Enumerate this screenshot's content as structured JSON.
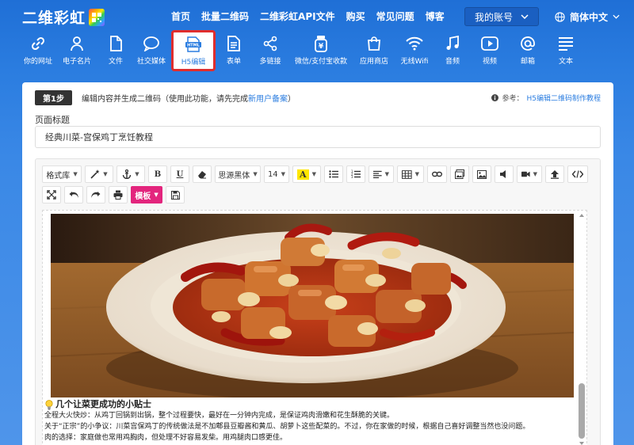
{
  "brand": {
    "name": "二维彩虹"
  },
  "nav": {
    "links": [
      "首页",
      "批量二维码",
      "二维彩虹API文件",
      "购买",
      "常见问题",
      "博客"
    ],
    "account": "我的账号",
    "language": "简体中文"
  },
  "categories": [
    {
      "label": "你的网址",
      "icon": "link-icon"
    },
    {
      "label": "电子名片",
      "icon": "person-icon"
    },
    {
      "label": "文件",
      "icon": "file-icon"
    },
    {
      "label": "社交媒体",
      "icon": "chat-icon"
    },
    {
      "label": "H5编辑",
      "icon": "html5-icon",
      "active": true
    },
    {
      "label": "表单",
      "icon": "form-icon"
    },
    {
      "label": "多链接",
      "icon": "share-icon"
    },
    {
      "label": "微信/支付宝收款",
      "icon": "payment-icon"
    },
    {
      "label": "应用商店",
      "icon": "store-icon"
    },
    {
      "label": "无线Wifi",
      "icon": "wifi-icon"
    },
    {
      "label": "音频",
      "icon": "music-icon"
    },
    {
      "label": "视频",
      "icon": "video-icon"
    },
    {
      "label": "邮箱",
      "icon": "at-icon"
    },
    {
      "label": "文本",
      "icon": "text-icon"
    }
  ],
  "step": {
    "badge": "第1步",
    "desc_prefix": "编辑内容并生成二维码（使用此功能，请先完成",
    "desc_link": "新用户备案",
    "desc_suffix": "）",
    "ref_label": "参考：",
    "ref_link": "H5编辑二维码制作教程"
  },
  "form": {
    "title_label": "页面标题",
    "title_value": "经典川菜-宫保鸡丁烹饪教程"
  },
  "toolbar": {
    "format": "格式库",
    "font": "思源黑体",
    "size": "14",
    "template": "模板"
  },
  "content": {
    "tip_title": "几个让菜更成功的小贴士",
    "tips": [
      "全程大火快炒：从鸡丁回锅到出锅，整个过程要快，最好在一分钟内完成，是保证鸡肉滑嫩和花生酥脆的关键。",
      "关于“正宗”的小争议：川菜宫保鸡丁的传统做法是不加郫县豆瓣酱和黄瓜、胡萝卜这些配菜的。不过，你在家做的时候，根据自己喜好调整当然也没问题。",
      "肉的选择：家庭做也常用鸡胸肉，但处理不好容易发柴。用鸡腿肉口感更佳。"
    ]
  },
  "colors": {
    "accent": "#2b7de0",
    "template_pink": "#e3257d",
    "active_border": "#e02d2d"
  }
}
